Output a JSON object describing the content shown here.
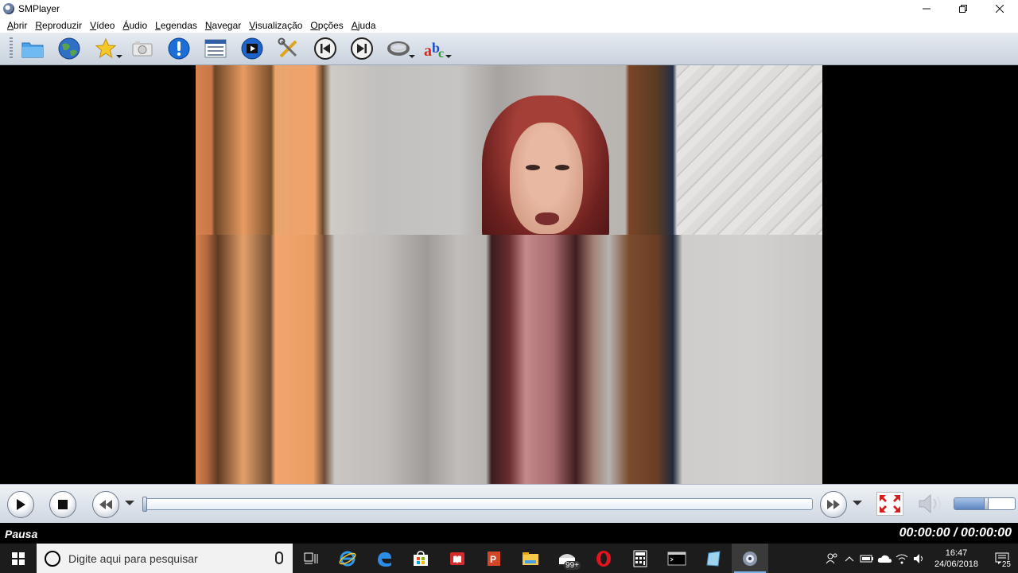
{
  "window": {
    "title": "SMPlayer",
    "minimize_icon": "minimize-icon",
    "maximize_icon": "restore-icon",
    "close_icon": "close-icon"
  },
  "menu": [
    {
      "label": "Abrir",
      "u": "A",
      "rest": "brir"
    },
    {
      "label": "Reproduzir",
      "u": "R",
      "rest": "eproduzir"
    },
    {
      "label": "Vídeo",
      "u": "V",
      "rest": "ídeo"
    },
    {
      "label": "Áudio",
      "u": "Á",
      "rest": "udio"
    },
    {
      "label": "Legendas",
      "u": "L",
      "rest": "egendas"
    },
    {
      "label": "Navegar",
      "u": "N",
      "rest": "avegar"
    },
    {
      "label": "Visualização",
      "u": "V",
      "rest": "isualização"
    },
    {
      "label": "Opções",
      "u": "O",
      "rest": "pções"
    },
    {
      "label": "Ajuda",
      "u": "A",
      "rest": "juda"
    }
  ],
  "toolbar": {
    "buttons": [
      "open-folder-icon",
      "web-globe-icon",
      "favorites-star-icon",
      "screenshot-camera-icon",
      "info-icon",
      "playlist-icon",
      "video-film-icon",
      "preferences-tools-icon",
      "previous-track-icon",
      "next-track-icon",
      "loop-icon",
      "subtitles-abc-icon"
    ]
  },
  "controls": {
    "play_icon": "play-icon",
    "stop_icon": "stop-icon",
    "rewind_icon": "rewind-icon",
    "forward_icon": "forward-icon",
    "fullscreen_icon": "fullscreen-icon",
    "volume_icon": "volume-icon",
    "seek_position": 0,
    "volume_level": 0.52
  },
  "status": {
    "state": "Pausa",
    "time": "00:00:00 / 00:00:00"
  },
  "taskbar": {
    "search_placeholder": "Digite aqui para pesquisar",
    "apps": [
      "task-view-icon",
      "internet-explorer-icon",
      "edge-icon",
      "store-icon",
      "reader-icon",
      "powerpoint-icon",
      "file-explorer-icon",
      "mail-icon",
      "opera-icon",
      "calculator-icon",
      "terminal-icon",
      "notes-icon",
      "smplayer-icon"
    ],
    "mail_badge": "99+",
    "clock_time": "16:47",
    "clock_date": "24/06/2018",
    "notification_count": "25"
  }
}
